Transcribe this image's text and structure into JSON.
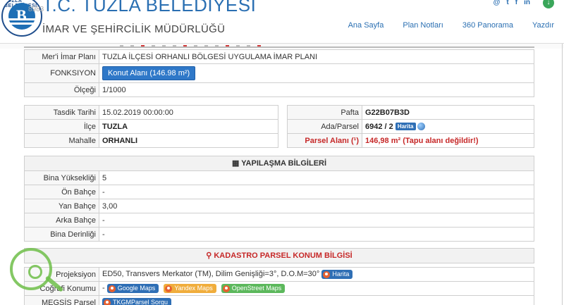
{
  "header": {
    "brand_title": "T.C. TUZLA BELEDİYESİ",
    "brand_sub": "İMAR VE ŞEHİRCİLİK MÜDÜRLÜĞÜ",
    "logo_text": "TUZLA BELEDİYESİ",
    "ghost_text": "8983",
    "nav": [
      "Ana Sayfa",
      "Plan Notları",
      "360 Panorama",
      "Yazdır"
    ],
    "social": [
      "@",
      "t",
      "f",
      "in"
    ]
  },
  "plan": {
    "meri_label": "Mer'i İmar Planı",
    "meri_value": "TUZLA İLÇESİ ORHANLI BÖLGESİ UYGULAMA İMAR PLANI",
    "fonksiyon_label": "FONKSIYON",
    "fonksiyon_button": "Konut Alanı (146.98 m²)",
    "olcek_label": "Ölçeği",
    "olcek_value": "1/1000"
  },
  "left_info": {
    "tasdik_label": "Tasdik Tarihi",
    "tasdik_value": "15.02.2019 00:00:00",
    "ilce_label": "İlçe",
    "ilce_value": "TUZLA",
    "mahalle_label": "Mahalle",
    "mahalle_value": "ORHANLI"
  },
  "right_info": {
    "pafta_label": "Pafta",
    "pafta_value": "G22B07B3D",
    "ada_label": "Ada/Parsel",
    "ada_value": "6942 / 2",
    "harita": "Harita",
    "parsel_label": "Parsel Alanı (¹)",
    "parsel_value": "146,98 m² (Tapu alanı değildir!)"
  },
  "yapilasma": {
    "title": "YAPILAŞMA BİLGİLERİ",
    "rows": [
      {
        "label": "Bina Yüksekliği",
        "value": "5"
      },
      {
        "label": "Ön Bahçe",
        "value": "-"
      },
      {
        "label": "Yan Bahçe",
        "value": "3,00"
      },
      {
        "label": "Arka Bahçe",
        "value": "-"
      },
      {
        "label": "Bina Derinliği",
        "value": "-"
      }
    ]
  },
  "kadastro": {
    "title": "KADASTRO PARSEL KONUM BİLGİSİ",
    "projeksiyon_label": "Projeksiyon",
    "projeksiyon_value": "ED50, Transvers Merkator (TM), Dilim Genişliği=3°, D.O.M=30°",
    "projeksiyon_harita": "Harita",
    "cografi_label": "Coğrafi Konumu",
    "cografi_dash": "-",
    "maps": [
      "Google Maps",
      "Yandex Maps",
      "OpenStreet Maps"
    ],
    "megsis_label": "MEGSİS Parsel",
    "megsis_button": "TKGMParsel Sorgu"
  },
  "colors": {
    "accent": "#2a6fb2",
    "danger": "#c62828",
    "button": "#2f78c8"
  }
}
